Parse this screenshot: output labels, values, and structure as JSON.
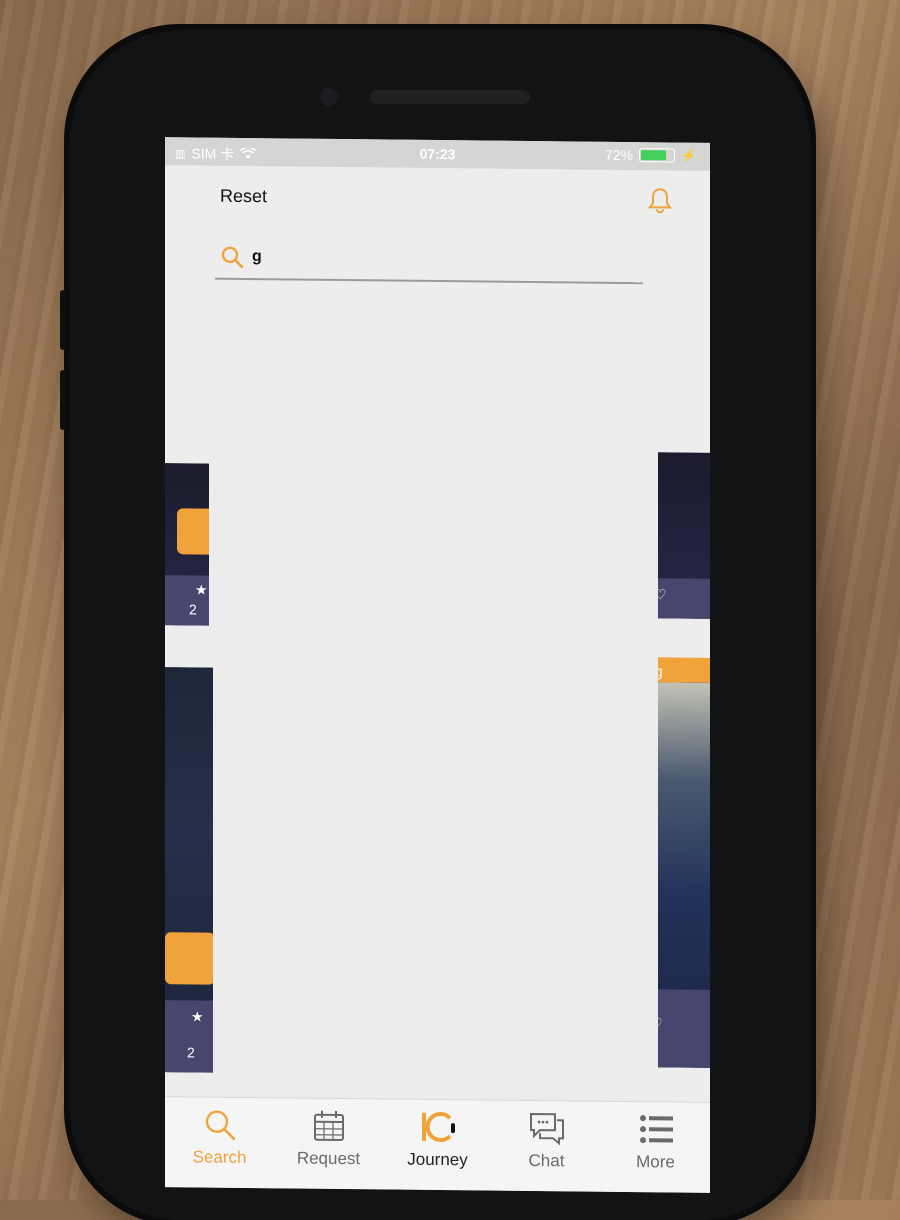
{
  "status_bar": {
    "carrier": "SIM 卡",
    "time": "07:23",
    "battery_percent": "72%",
    "battery_level": 0.72,
    "wifi_icon": "wifi-icon",
    "charging_icon": "charging-bolt-icon"
  },
  "header": {
    "reset_label": "Reset",
    "bell_icon": "bell-icon"
  },
  "search": {
    "value": "g",
    "icon": "search-icon"
  },
  "background_cards": {
    "tag_text": "ng",
    "left_card_count_1": "2",
    "left_card_count_2": "2"
  },
  "tab_bar": {
    "items": [
      {
        "label": "Search",
        "icon": "search-icon",
        "active": true
      },
      {
        "label": "Request",
        "icon": "calendar-icon",
        "active": false
      },
      {
        "label": "Journey",
        "icon": "journey-logo-icon",
        "active": false
      },
      {
        "label": "Chat",
        "icon": "chat-bubble-icon",
        "active": false
      },
      {
        "label": "More",
        "icon": "list-icon",
        "active": false
      }
    ]
  },
  "colors": {
    "accent": "#f0a23b",
    "card_dark": "#2b2b4f",
    "rating_bar": "#47466e"
  }
}
